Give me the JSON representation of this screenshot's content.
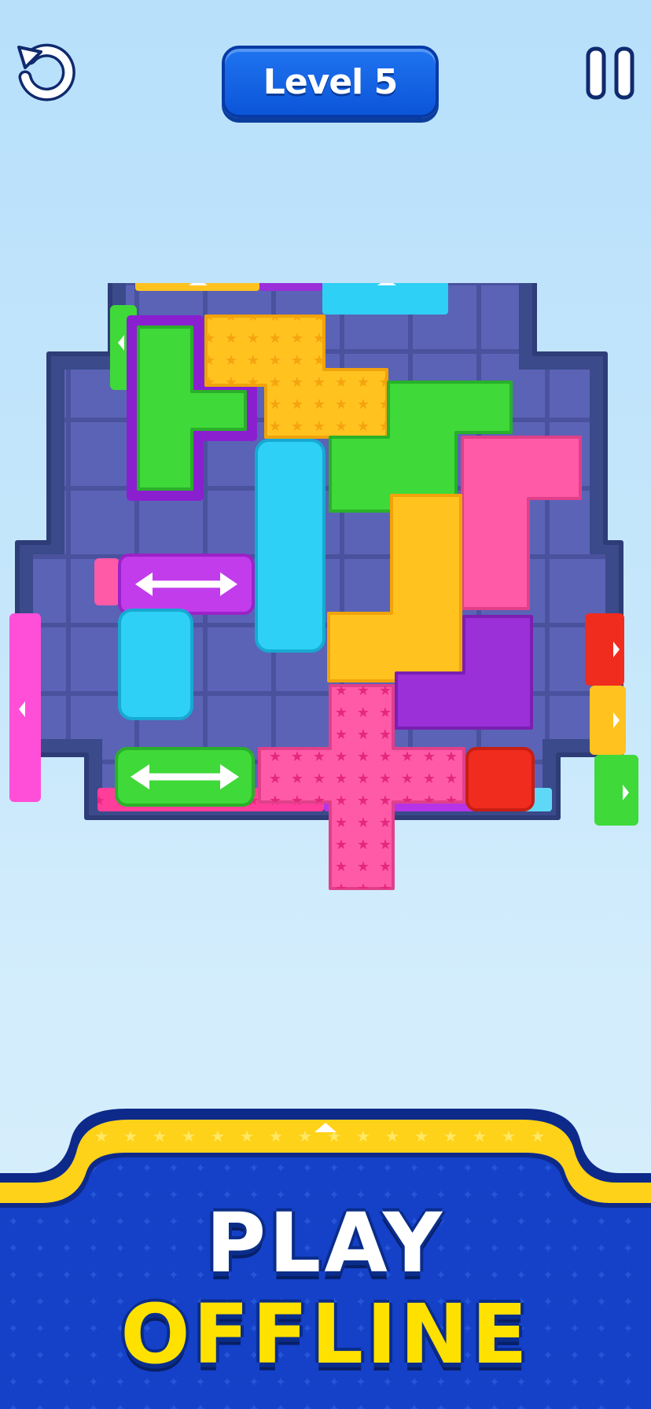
{
  "header": {
    "level_label": "Level 5",
    "restart_icon": "restart-icon",
    "pause_icon": "pause-icon"
  },
  "banner": {
    "line1": "PLAY",
    "line2": "OFFLINE"
  },
  "colors": {
    "background": "#c6e7fb",
    "level_badge": "#0c55d9",
    "banner_blue": "#1540c8",
    "banner_yellow": "#ffd21a",
    "board": "#5a62b4",
    "board_rim": "#3a4a8a"
  },
  "board": {
    "pieces": [
      {
        "name": "green-t-piece-selected",
        "color": "#3fd93a"
      },
      {
        "name": "yellow-star-piece",
        "color": "#ffc21f"
      },
      {
        "name": "green-s-piece",
        "color": "#3fd93a"
      },
      {
        "name": "cyan-tall-bar",
        "color": "#2ed0f5"
      },
      {
        "name": "pink-hook-piece",
        "color": "#ff5aa8"
      },
      {
        "name": "purple-arrow-piece",
        "color": "#b634e8"
      },
      {
        "name": "yellow-l-piece",
        "color": "#ffc21f"
      },
      {
        "name": "cyan-short-bar",
        "color": "#2ed0f5"
      },
      {
        "name": "purple-l-piece",
        "color": "#9b2fd8"
      },
      {
        "name": "green-arrow-piece",
        "color": "#3fd93a"
      },
      {
        "name": "pink-star-cross",
        "color": "#ff5aa8"
      },
      {
        "name": "red-square",
        "color": "#f02c1e"
      }
    ],
    "gates": [
      {
        "name": "top-yellow-gate",
        "color": "#ffc21f"
      },
      {
        "name": "top-purple-gate",
        "color": "#9b2fd8"
      },
      {
        "name": "top-cyan-gate",
        "color": "#2ed0f5"
      },
      {
        "name": "left-green-gate",
        "color": "#3fd93a"
      },
      {
        "name": "left-pink-gate",
        "color": "#ff5aa8"
      },
      {
        "name": "left-magenta-gate",
        "color": "#ff4fd8"
      },
      {
        "name": "right-red-gate",
        "color": "#f02c1e"
      },
      {
        "name": "right-yellow-gate",
        "color": "#ffc21f"
      },
      {
        "name": "right-green-gate",
        "color": "#3fd93a"
      },
      {
        "name": "bottom-pink-star-gate",
        "color": "#ff3d9a"
      },
      {
        "name": "bottom-purple-gate",
        "color": "#b634e8"
      },
      {
        "name": "bottom-cyan-gate",
        "color": "#5fd8f7"
      }
    ]
  }
}
